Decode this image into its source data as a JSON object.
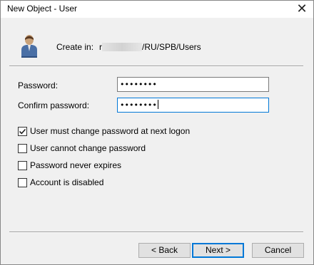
{
  "window": {
    "title": "New Object - User",
    "close_glyph": "✕"
  },
  "header": {
    "create_in_label": "Create in:",
    "create_in_prefix": "r",
    "create_in_path": "/RU/SPB/Users"
  },
  "fields": {
    "password_label": "Password:",
    "password_value": "••••••••",
    "confirm_label": "Confirm password:",
    "confirm_value": "••••••••"
  },
  "options": [
    {
      "label": "User must change password at next logon",
      "checked": true
    },
    {
      "label": "User cannot change password",
      "checked": false
    },
    {
      "label": "Password never expires",
      "checked": false
    },
    {
      "label": "Account is disabled",
      "checked": false
    }
  ],
  "buttons": {
    "back": "< Back",
    "next": "Next >",
    "cancel": "Cancel"
  },
  "colors": {
    "focus": "#0078d7",
    "face": "#f0f0f0",
    "button": "#e1e1e1"
  },
  "icons": {
    "object": "user-icon",
    "close": "close-icon",
    "check": "check-icon"
  }
}
